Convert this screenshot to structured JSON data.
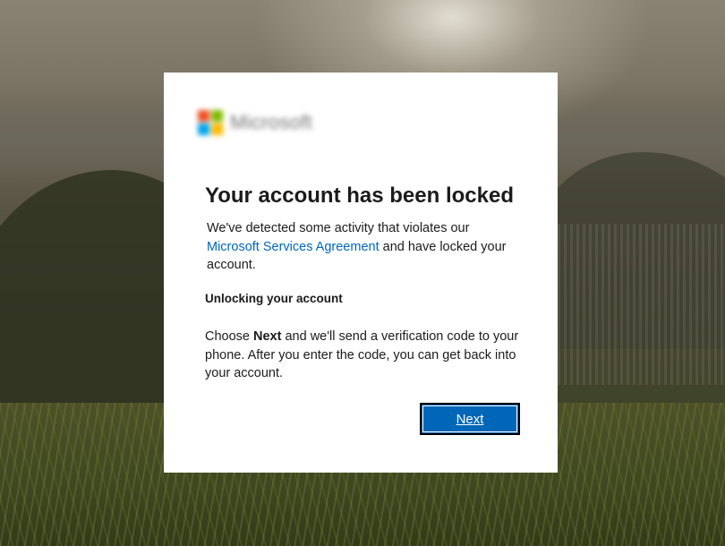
{
  "colors": {
    "accent": "#0067b8",
    "logo_red": "#f25022",
    "logo_green": "#7fba00",
    "logo_blue": "#00a4ef",
    "logo_yellow": "#ffb900"
  },
  "logo": {
    "icon": "microsoft-logo-icon",
    "text": "Microsoft"
  },
  "dialog": {
    "title": "Your account has been locked",
    "description_before": "We've detected some activity that violates our ",
    "agreement_link": "Microsoft Services Agreement",
    "description_after": " and have locked your account.",
    "subheading": "Unlocking your account",
    "instructions_before": "Choose ",
    "instructions_bold": "Next",
    "instructions_after": " and we'll send a verification code to your phone. After you enter the code, you can get back into your account.",
    "next_button": "Next"
  }
}
